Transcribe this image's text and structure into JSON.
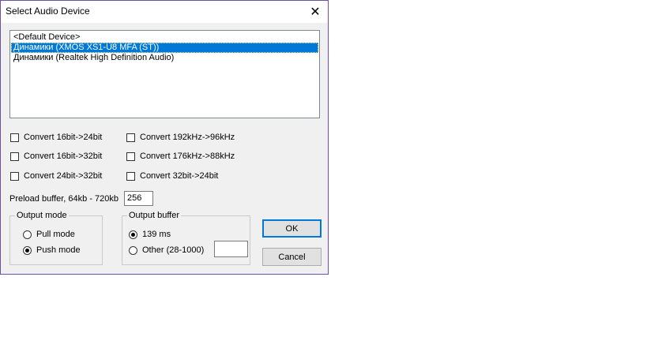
{
  "window": {
    "title": "Select Audio Device",
    "close_glyph": "✕"
  },
  "devices": [
    {
      "label": "<Default Device>",
      "selected": false
    },
    {
      "label": "Динамики (XMOS XS1-U8 MFA (ST))",
      "selected": true
    },
    {
      "label": "Динамики (Realtek High Definition Audio)",
      "selected": false
    }
  ],
  "conversions_left": [
    {
      "label": "Convert 16bit->24bit",
      "checked": false
    },
    {
      "label": "Convert 16bit->32bit",
      "checked": false
    },
    {
      "label": "Convert 24bit->32bit",
      "checked": false
    }
  ],
  "conversions_right": [
    {
      "label": "Convert 192kHz->96kHz",
      "checked": false
    },
    {
      "label": "Convert 176kHz->88kHz",
      "checked": false
    },
    {
      "label": "Convert 32bit->24bit",
      "checked": false
    }
  ],
  "preload": {
    "label": "Preload buffer, 64kb - 720kb",
    "value": "256"
  },
  "output_mode": {
    "title": "Output mode",
    "options": [
      {
        "label": "Pull mode",
        "selected": false
      },
      {
        "label": "Push mode",
        "selected": true
      }
    ]
  },
  "output_buffer": {
    "title": "Output buffer",
    "options": [
      {
        "label": "139 ms",
        "selected": true
      },
      {
        "label": "Other (28-1000)",
        "selected": false
      }
    ],
    "other_value": ""
  },
  "buttons": {
    "ok": "OK",
    "cancel": "Cancel"
  }
}
